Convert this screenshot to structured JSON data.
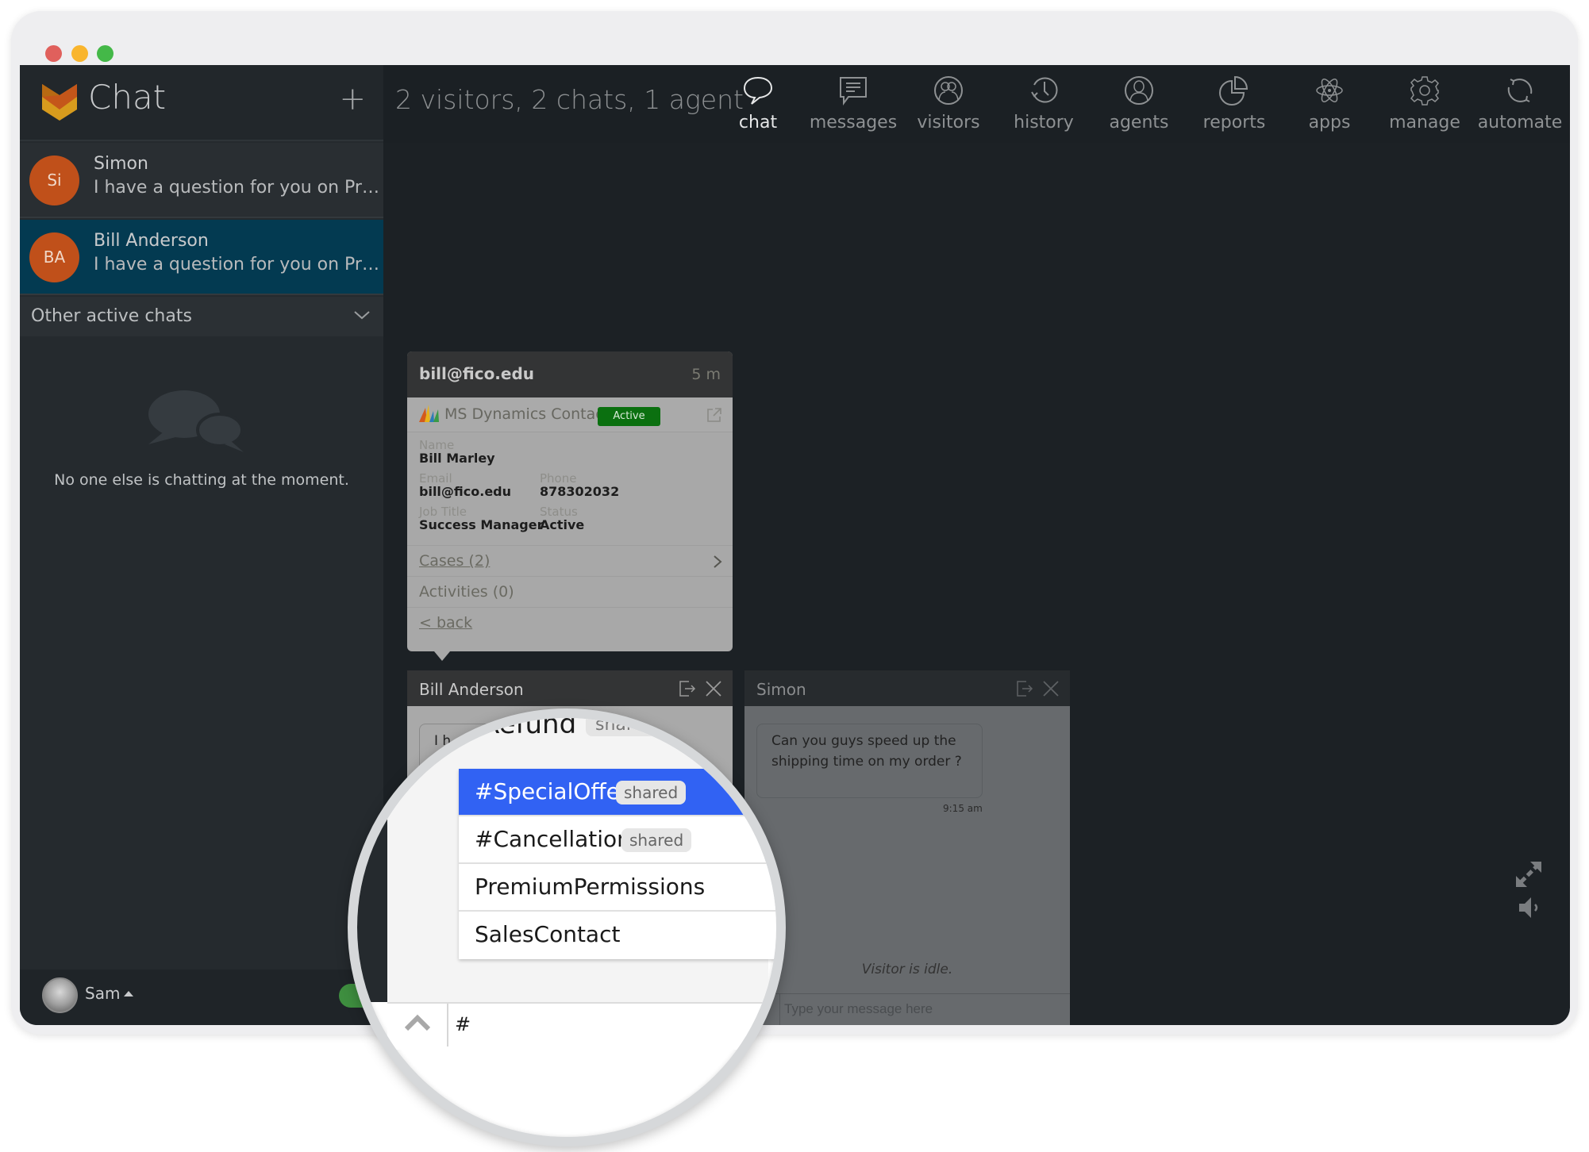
{
  "window": {
    "controls": [
      "close",
      "minimize",
      "maximize"
    ]
  },
  "sidebar": {
    "title": "Chat",
    "add_label": "+",
    "chats": [
      {
        "initials": "Si",
        "name": "Simon",
        "preview": "I have a question for you on Pr…",
        "selected": false
      },
      {
        "initials": "BA",
        "name": "Bill Anderson",
        "preview": "I have a question for you on Pr…",
        "selected": true
      }
    ],
    "other_chats_label": "Other active chats",
    "empty_message": "No one else is chatting at the moment.",
    "user": {
      "name": "Sam",
      "online": true
    }
  },
  "topbar": {
    "stats": "2 visitors, 2 chats, 1 agent",
    "nav": [
      {
        "label": "chat",
        "icon": "speech-bubble-icon",
        "active": true
      },
      {
        "label": "messages",
        "icon": "message-icon",
        "active": false
      },
      {
        "label": "visitors",
        "icon": "visitors-icon",
        "active": false
      },
      {
        "label": "history",
        "icon": "history-icon",
        "active": false
      },
      {
        "label": "agents",
        "icon": "agent-icon",
        "active": false
      },
      {
        "label": "reports",
        "icon": "pie-chart-icon",
        "active": false
      },
      {
        "label": "apps",
        "icon": "atom-icon",
        "active": false
      },
      {
        "label": "manage",
        "icon": "gear-icon",
        "active": false
      },
      {
        "label": "automate",
        "icon": "refresh-icon",
        "active": false
      }
    ]
  },
  "crm": {
    "email": "bill@fico.edu",
    "age": "5 m",
    "source": "MS Dynamics Contact",
    "status_badge": "Active",
    "fields": {
      "name_label": "Name",
      "name": "Bill Marley",
      "email_label": "Email",
      "email": "bill@fico.edu",
      "phone_label": "Phone",
      "phone": "878302032",
      "job_label": "Job Title",
      "job": "Success Manager",
      "status_label": "Status",
      "status": "Active"
    },
    "cases": "Cases (2)",
    "activities": "Activities (0)",
    "back": "< back"
  },
  "chat_windows": [
    {
      "title": "Bill Anderson",
      "message_partial": "I h"
    },
    {
      "title": "Simon",
      "message": "Can you guys speed up the shipping time on my order ?",
      "time": "9:15 am",
      "status": "Visitor is idle.",
      "input_placeholder": "Type your message here"
    }
  ],
  "canned_responses": {
    "partial_top": "#Refund",
    "partial_top_badge": "shared",
    "items": [
      {
        "label": "#SpecialOffer",
        "badge": "shared",
        "highlighted": true
      },
      {
        "label": "#Cancellation",
        "badge": "shared",
        "highlighted": false
      },
      {
        "label": "PremiumPermissions",
        "badge": "",
        "highlighted": false
      },
      {
        "label": "SalesContact",
        "badge": "",
        "highlighted": false
      }
    ],
    "input_value": "#"
  },
  "colors": {
    "accent_highlight": "#3162f3",
    "selected_chat": "#033a51",
    "avatar": "#c0501a",
    "active_badge": "#0b7010",
    "online_toggle": "#3e8e3f"
  }
}
